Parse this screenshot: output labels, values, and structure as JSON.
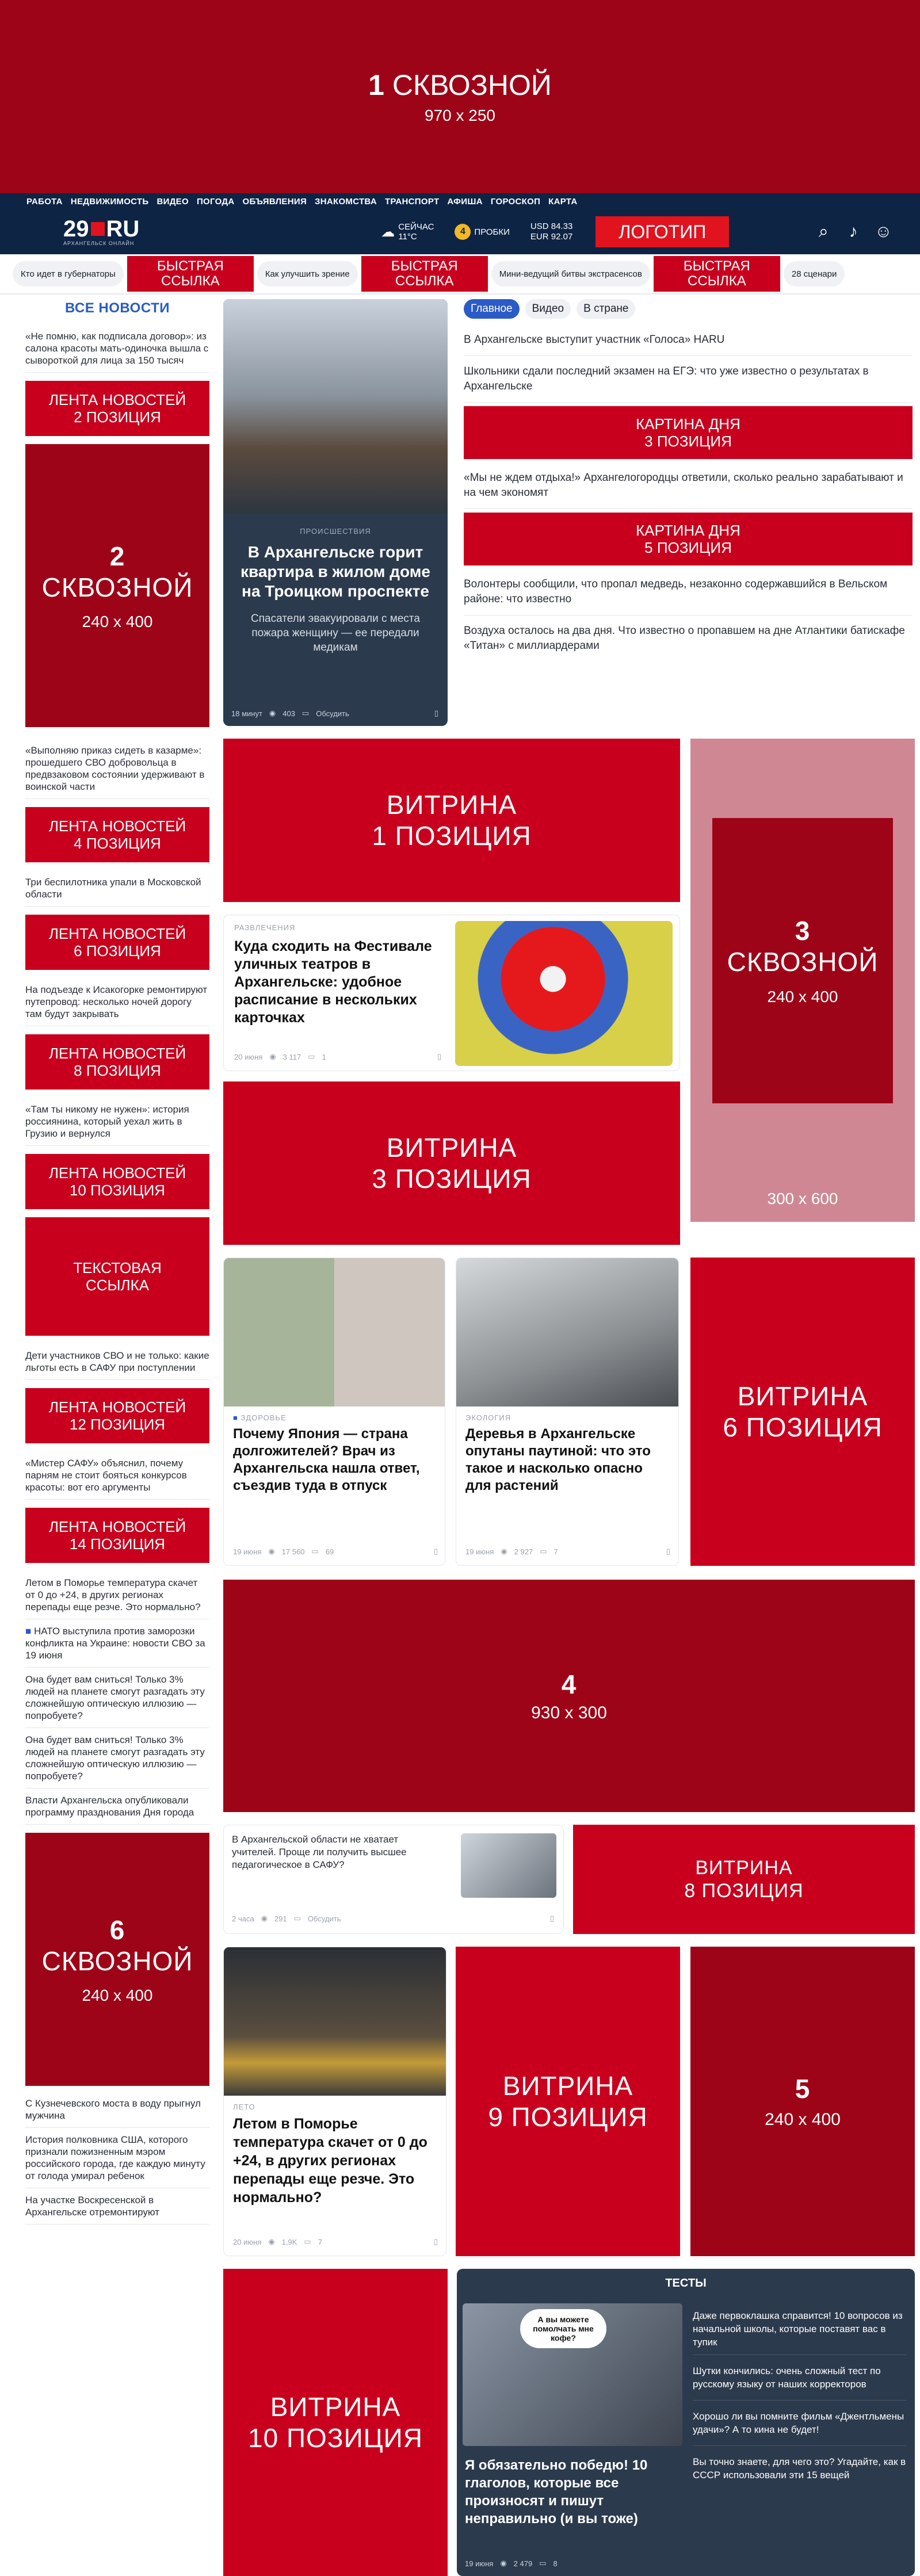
{
  "top_banner": {
    "number": "1",
    "label": "СКВОЗНОЙ",
    "size": "970 x 250"
  },
  "rubrics": [
    "РАБОТА",
    "НЕДВИЖИМОСТЬ",
    "ВИДЕО",
    "ПОГОДА",
    "ОБЪЯВЛЕНИЯ",
    "ЗНАКОМСТВА",
    "ТРАНСПОРТ",
    "АФИША",
    "ГОРОСКОП",
    "КАРТА"
  ],
  "header": {
    "logo_main": "29",
    "logo_ru": "RU",
    "logo_sub": "АРХАНГЕЛЬСК ОНЛАЙН",
    "weather_label": "СЕЙЧАС",
    "weather_value": "11°C",
    "traffic_num": "4",
    "traffic_label": "ПРОБКИ",
    "usd": "USD 84.33",
    "eur": "EUR 92.07",
    "logo_button": "ЛОГОТИП"
  },
  "quicklinks": {
    "pills": [
      "Кто идет в губернаторы",
      "Как улучшить зрение",
      "Мини-ведущий битвы экстрасенсов",
      "28 сценари"
    ],
    "red_label": "БЫСТРАЯ ССЫЛКА"
  },
  "left_column": {
    "heading": "ВСЕ НОВОСТИ",
    "news": [
      "«Не помню, как подписала договор»: из салона красоты мать-одиночка вышла с сывороткой для лица за 150 тысяч",
      "«Выполняю приказ сидеть в казарме»: прошедшего СВО добровольца в предвзаковом состоянии удерживают в воинской части",
      "Три беспилотника упали в Московской области",
      "На подъезде к Исакогорке ремонтируют путепровод: несколько ночей дорогу там будут закрывать",
      "«Там ты никому не нужен»: история россиянина, который уехал жить в Грузию и вернулся",
      "Дети участников СВО и не только: какие льготы есть в САФУ при поступлении",
      "«Мистер САФУ» объяснил, почему парням не стоит бояться конкурсов красоты: вот его аргументы",
      "Летом в Поморье температура скачет от 0 до +24, в других регионах перепады еще резче. Это нормально?",
      "НАТО выступила против заморозки конфликта на Украине: новости СВО за 19 июня",
      "Она будет вам сниться! Только 3% людей на планете смогут разгадать эту сложнейшую оптическую иллюзию — попробуете?",
      "Она будет вам сниться! Только 3% людей на планете смогут разгадать эту сложнейшую оптическую иллюзию — попробуете?",
      "Власти Архангельска опубликовали программу празднования Дня города",
      "С Кузнечевского моста в воду прыгнул мужчина",
      "История полковника США, которого признали пожизненным мэром российского города, где каждую минуту от голода умирал ребенок",
      "На участке Воскресенской в Архангельске отремонтируют"
    ],
    "lenta": [
      "ЛЕНТА НОВОСТЕЙ",
      "2 ПОЗИЦИЯ",
      "4 ПОЗИЦИЯ",
      "6 ПОЗИЦИЯ",
      "8 ПОЗИЦИЯ",
      "10 ПОЗИЦИЯ",
      "12 ПОЗИЦИЯ",
      "14 ПОЗИЦИЯ"
    ],
    "text_link": "ТЕКСТОВАЯ ССЫЛКА",
    "banner2": {
      "number": "2",
      "label": "СКВОЗНОЙ",
      "size": "240 x 400"
    },
    "banner6": {
      "number": "6",
      "label": "СКВОЗНОЙ",
      "size": "240 x 400"
    }
  },
  "main_card": {
    "rubric": "ПРОИСШЕСТВИЯ",
    "title": "В Архангельске горит квартира в жилом доме на Троицком проспекте",
    "lead": "Спасатели эвакуировали с места пожара женщину — ее передали медикам",
    "time": "18 минут",
    "views": "403",
    "comment": "Обсудить"
  },
  "right_feed": {
    "tabs": [
      "Главное",
      "Видео",
      "В стране"
    ],
    "items": [
      "В Архангельске выступит участник «Голоса» HARU",
      "Школьники сдали последний экзамен на ЕГЭ: что уже известно о результатах в Архангельске",
      "«Мы не ждем отдыха!» Архангелогородцы ответили, сколько реально зарабатывают и на чем экономят",
      "Волонтеры сообщили, что пропал медведь, незаконно содержавшийся в Вельском районе: что известно",
      "Воздуха осталось на два дня. Что известно о пропавшем на дне Атлантики батискафе «Титан» с миллиардерами"
    ],
    "kartina_label": "КАРТИНА ДНЯ",
    "kartina3": "3 ПОЗИЦИЯ",
    "kartina5": "5 ПОЗИЦИЯ"
  },
  "vitrina": {
    "label": "ВИТРИНА",
    "p1": "1 ПОЗИЦИЯ",
    "p3": "3 ПОЗИЦИЯ",
    "p6": "6 ПОЗИЦИЯ",
    "p8": "8 ПОЗИЦИЯ",
    "p9": "9 ПОЗИЦИЯ",
    "p10": "10 ПОЗИЦИЯ"
  },
  "banner3": {
    "number": "3",
    "label": "СКВОЗНОЙ",
    "size": "240 x 400",
    "size2": "300 x 600"
  },
  "banner4": {
    "number": "4",
    "size": "930 x 300"
  },
  "banner5": {
    "number": "5",
    "size": "240 x 400"
  },
  "card_festival": {
    "rubric": "РАЗВЛЕЧЕНИЯ",
    "title": "Куда сходить на Фестивале уличных театров в Архангельске: удобное расписание в нескольких карточках",
    "date": "20 июня",
    "views": "3 117",
    "comments": "1"
  },
  "card_japan": {
    "rubric": "ЗДОРОВЬЕ",
    "title": "Почему Япония — страна долгожителей? Врач из Архангельска нашла ответ, съездив туда в отпуск",
    "date": "19 июня",
    "views": "17 560",
    "comments": "69"
  },
  "card_trees": {
    "rubric": "ЭКОЛОГИЯ",
    "title": "Деревья в Архангельске опутаны паутиной: что это такое и насколько опасно для растений",
    "date": "19 июня",
    "views": "2 927",
    "comments": "7"
  },
  "card_teachers": {
    "title": "В Архангельской области не хватает учителей. Проще ли получить высшее педагогическое в САФУ?",
    "date": "2 часа",
    "views": "291",
    "comment": "Обсудить"
  },
  "card_weather": {
    "rubric": "ЛЕТО",
    "title": "Летом в Поморье температура скачет от 0 до +24, в других регионах перепады еще резче. Это нормально?",
    "date": "20 июня",
    "views": "1,9K",
    "comments": "7"
  },
  "tests": {
    "heading": "ТЕСТЫ",
    "bubble": "А вы можете помолчать мне кофе?",
    "title": "Я обязательно победю! 10 глаголов, которые все произносят и пишут неправильно (и вы тоже)",
    "date": "19 июня",
    "views": "2 479",
    "comments": "8",
    "items": [
      "Даже первоклашка справится! 10 вопросов из начальной школы, которые поставят вас в тупик",
      "Шутки кончились: очень сложный тест по русскому языку от наших корректоров",
      "Хорошо ли вы помните фильм «Джентльмены удачи»? А то кина не будет!",
      "Вы точно знаете, для чего это? Угадайте, как в СССР использовали эти 15 вещей"
    ]
  }
}
